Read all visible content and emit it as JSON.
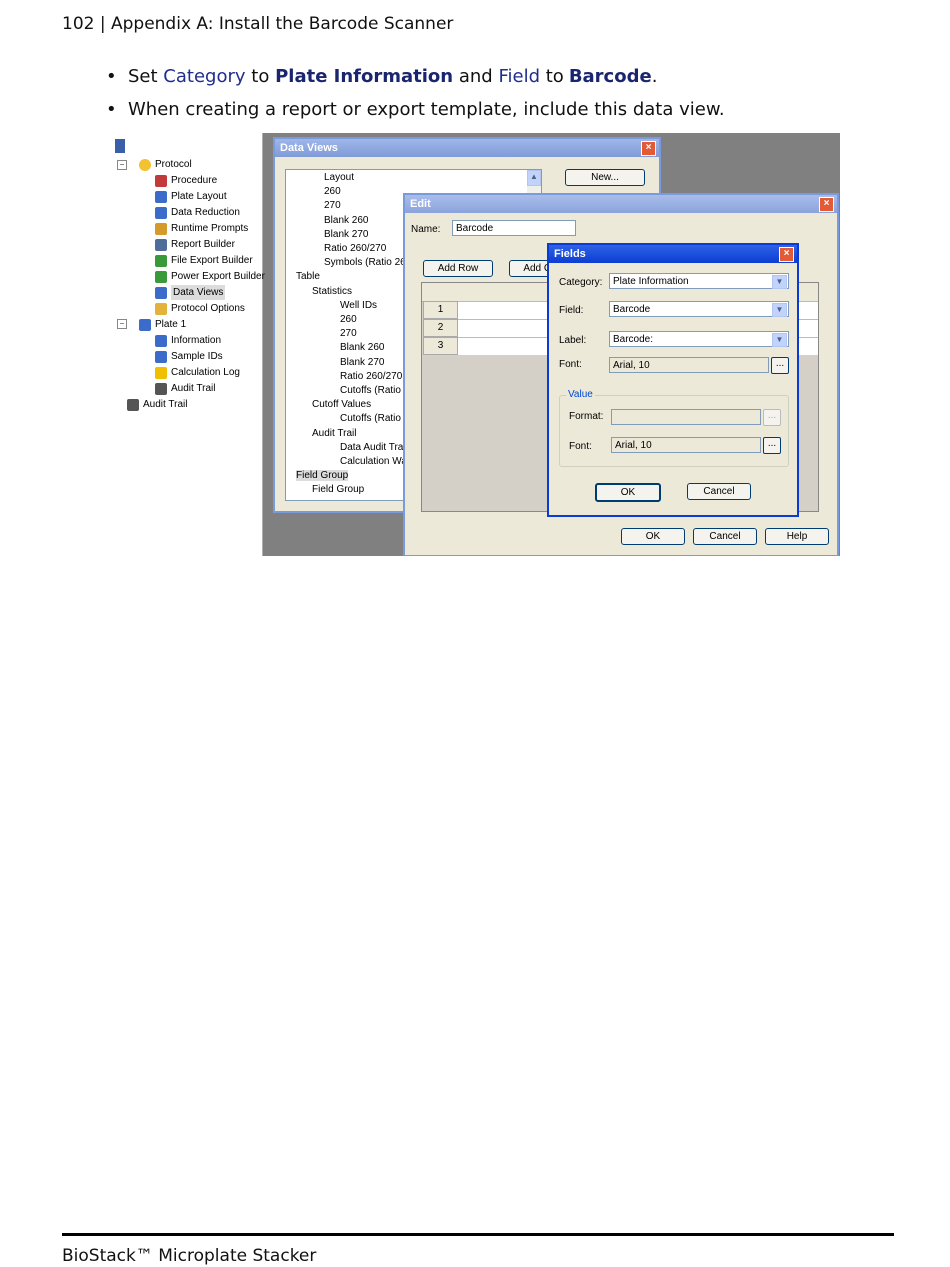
{
  "header": {
    "text": "102 | Appendix A: Install the Barcode Scanner"
  },
  "bullets": {
    "b1": {
      "w1": "Set",
      "k1": "Category",
      "w2": "to",
      "v1": "Plate Information",
      "w3": "and",
      "k2": "Field",
      "w4": "to",
      "v2": "Barcode",
      "end": "."
    },
    "b2": {
      "text": "When creating a report or export template, include this data view."
    }
  },
  "tree": {
    "items": [
      {
        "label": "Protocol"
      },
      {
        "label": "Procedure"
      },
      {
        "label": "Plate Layout"
      },
      {
        "label": "Data Reduction"
      },
      {
        "label": "Runtime Prompts"
      },
      {
        "label": "Report Builder"
      },
      {
        "label": "File Export Builder"
      },
      {
        "label": "Power Export Builder"
      },
      {
        "label": "Data Views"
      },
      {
        "label": "Protocol Options"
      },
      {
        "label": "Plate 1"
      },
      {
        "label": "Information"
      },
      {
        "label": "Sample IDs"
      },
      {
        "label": "Calculation Log"
      },
      {
        "label": "Audit Trail"
      },
      {
        "label": "Audit Trail"
      }
    ],
    "icons": [
      "protocol-icon",
      "procedure-icon",
      "plate-layout-icon",
      "data-reduction-icon",
      "runtime-prompts-icon",
      "report-builder-icon",
      "file-export-icon",
      "power-export-icon",
      "data-views-icon",
      "protocol-options-icon",
      "plate-icon",
      "information-icon",
      "sample-ids-icon",
      "warning-icon",
      "audit-trail-icon",
      "audit-trail-icon"
    ]
  },
  "data_views": {
    "title": "Data Views",
    "new_button": "New...",
    "lines": [
      "Layout",
      "260",
      "270",
      "Blank 260",
      "Blank 270",
      "Ratio 260/270",
      "Symbols (Ratio 260",
      "Table",
      "Statistics",
      "Well IDs",
      "260",
      "270",
      "Blank 260",
      "Blank 270",
      "Ratio 260/270",
      "Cutoffs (Ratio",
      "Cutoff Values",
      "Cutoffs (Ratio",
      "Audit Trail",
      "Data Audit Tra",
      "Calculation Wa",
      "Field Group",
      "Field Group"
    ]
  },
  "edit": {
    "title": "Edit",
    "name_label": "Name:",
    "name_value": "Barcode",
    "add_row": "Add Row",
    "add_col": "Add Co",
    "rows": [
      "1",
      "2",
      "3"
    ],
    "ok": "OK",
    "cancel": "Cancel",
    "help": "Help"
  },
  "fields": {
    "title": "Fields",
    "category_label": "Category:",
    "category_value": "Plate Information",
    "field_label": "Field:",
    "field_value": "Barcode",
    "label_label": "Label:",
    "label_value": "Barcode:",
    "font_label": "Font:",
    "font_value": "Arial, 10",
    "value_group": "Value",
    "format_label": "Format:",
    "format_value": "",
    "value_font_label": "Font:",
    "value_font_value": "Arial, 10",
    "dots": "...",
    "ok": "OK",
    "cancel": "Cancel"
  },
  "footer": {
    "text": "BioStack™ Microplate Stacker"
  }
}
